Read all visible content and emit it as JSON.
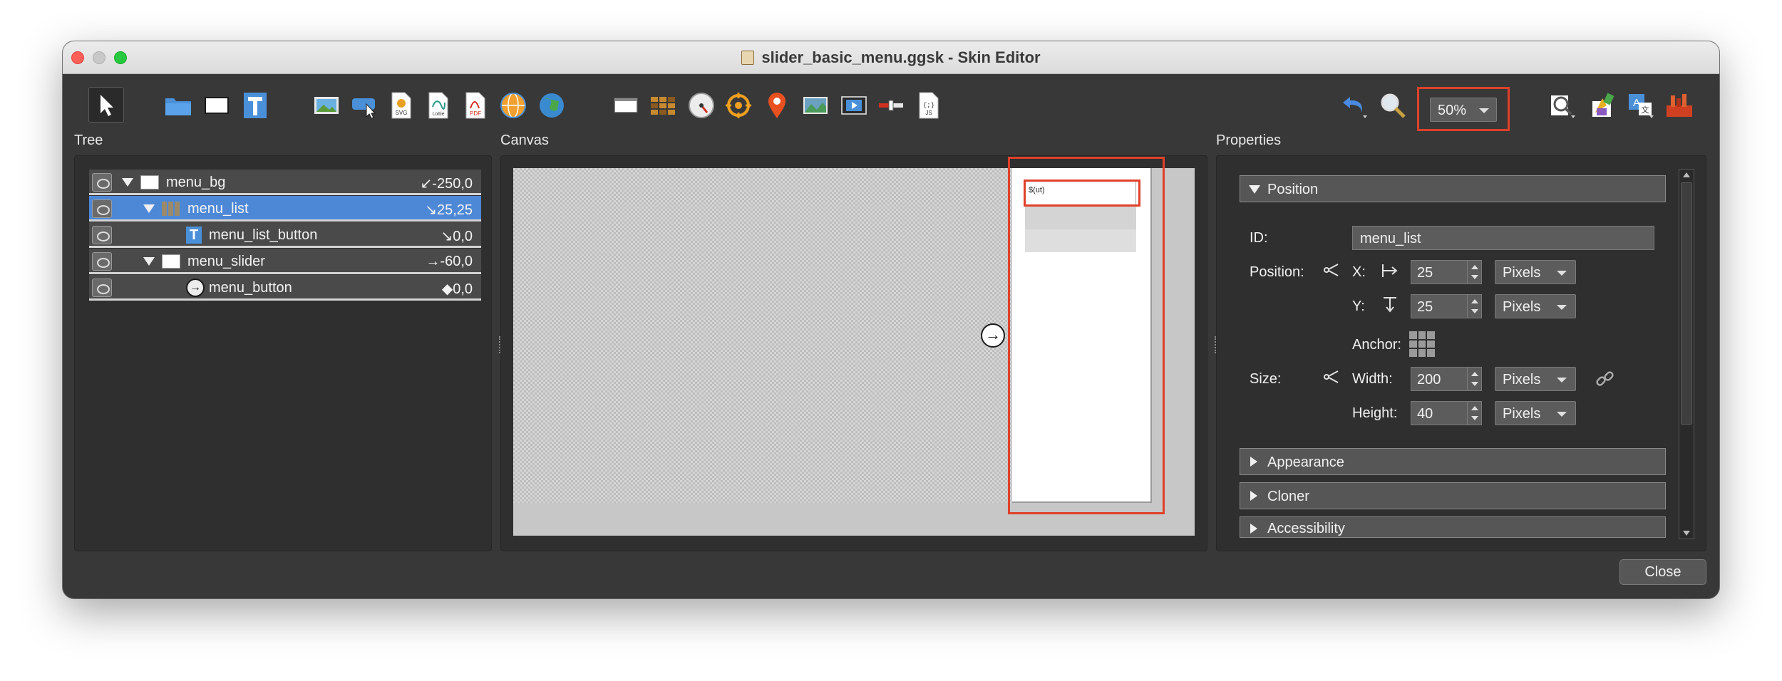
{
  "window": {
    "title": "slider_basic_menu.ggsk - Skin Editor"
  },
  "toolbar": {
    "tools": [
      "select-tool",
      "folder-tool",
      "rectangle-tool",
      "text-tool",
      "image-tool",
      "button-tool",
      "svg-tool",
      "lottie-tool",
      "pdf-tool",
      "panorama-tool",
      "map-tool",
      "screen-tool",
      "grid-tool",
      "compass-tool",
      "hotspot-tool",
      "pin-tool",
      "mapview-tool",
      "video-tool",
      "slider-tool",
      "javascript-tool"
    ],
    "svg_label": "SVG",
    "lottie_label": "Lottie",
    "pdf_label": "PDF",
    "js_label": "JS",
    "zoom": "50%"
  },
  "tree": {
    "label": "Tree",
    "rows": [
      {
        "name": "menu_bg",
        "value": "↙-250,0"
      },
      {
        "name": "menu_list",
        "value": "↘25,25"
      },
      {
        "name": "menu_list_button",
        "value": "↘0,0"
      },
      {
        "name": "menu_slider",
        "value": "→-60,0"
      },
      {
        "name": "menu_button",
        "value": "◆0,0"
      }
    ]
  },
  "canvas": {
    "label": "Canvas",
    "placeholder_text": "$(ut)"
  },
  "properties": {
    "label": "Properties",
    "position_section": "Position",
    "id_label": "ID:",
    "id_value": "menu_list",
    "position_label": "Position:",
    "x_label": "X:",
    "x_value": "25",
    "x_unit": "Pixels",
    "y_label": "Y:",
    "y_value": "25",
    "y_unit": "Pixels",
    "anchor_label": "Anchor:",
    "size_label": "Size:",
    "width_label": "Width:",
    "width_value": "200",
    "width_unit": "Pixels",
    "height_label": "Height:",
    "height_value": "40",
    "height_unit": "Pixels",
    "appearance_section": "Appearance",
    "cloner_section": "Cloner",
    "accessibility_section": "Accessibility"
  },
  "footer": {
    "close_label": "Close"
  },
  "colors": {
    "highlight": "#e0402a",
    "selection": "#4d88d7",
    "window_bg": "#383838"
  }
}
